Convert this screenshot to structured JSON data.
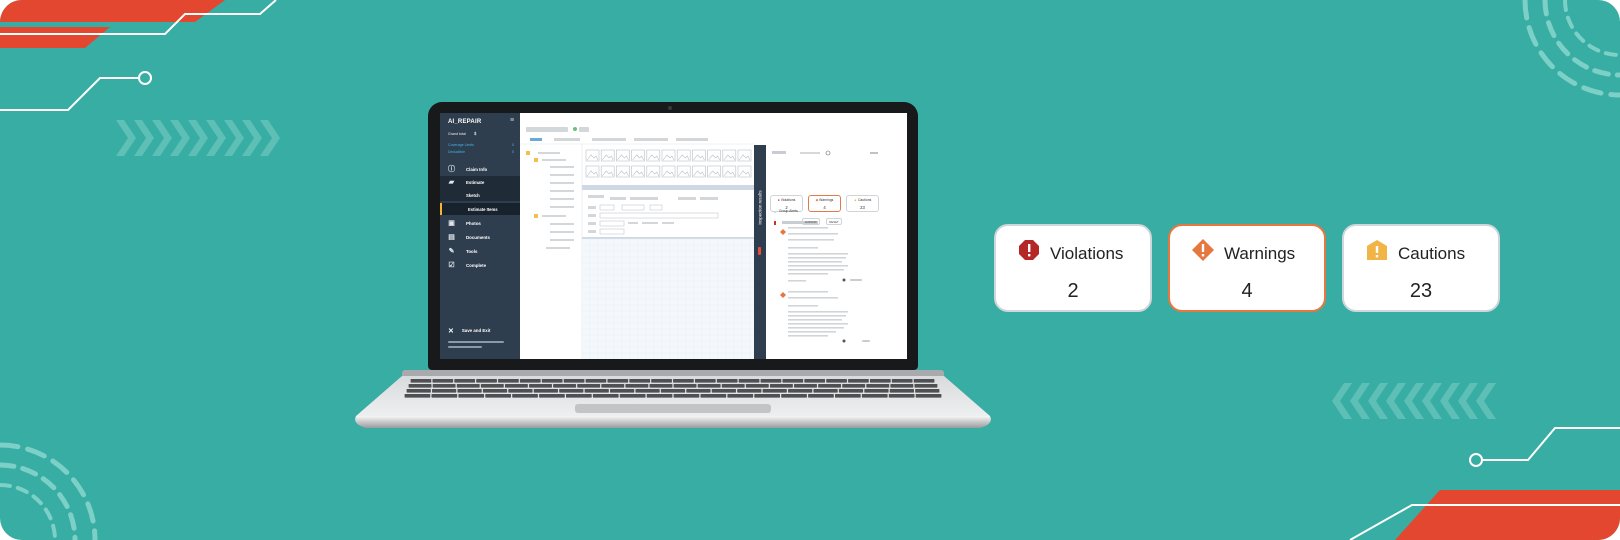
{
  "app": {
    "brand": "AI_REPAIR",
    "grand_total_label": "Grand total",
    "grand_total_value": "$",
    "links": [
      {
        "label": "Coverage Limits",
        "count": "0"
      },
      {
        "label": "Deductible",
        "count": "0"
      }
    ],
    "nav": [
      {
        "label": "Claim Info",
        "icon": "info-icon"
      },
      {
        "label": "Estimate",
        "icon": "car-icon"
      },
      {
        "label": "Sketch",
        "icon": ""
      },
      {
        "label": "Estimate Items",
        "icon": ""
      },
      {
        "label": "Photos",
        "icon": "photo-icon"
      },
      {
        "label": "Documents",
        "icon": "document-icon"
      },
      {
        "label": "Tools",
        "icon": "wrench-icon"
      },
      {
        "label": "Complete",
        "icon": "check-icon"
      }
    ],
    "save_label": "Save and Exit"
  },
  "inspection": {
    "tab_label": "Inspection results",
    "cards": [
      {
        "label": "Violations",
        "value": "2"
      },
      {
        "label": "Warnings",
        "value": "4"
      },
      {
        "label": "Cautions",
        "value": "23"
      }
    ],
    "buttons": [
      "EXPAND",
      "RESET"
    ],
    "group_alerts": "Group Alerts"
  },
  "summary": [
    {
      "label": "Violations",
      "value": "2",
      "icon": "violation-octagon-icon",
      "color": "#B52626"
    },
    {
      "label": "Warnings",
      "value": "4",
      "icon": "warning-diamond-icon",
      "color": "#E5773F"
    },
    {
      "label": "Cautions",
      "value": "23",
      "icon": "caution-shield-icon",
      "color": "#F2B446"
    }
  ],
  "colors": {
    "background": "#38ADA3",
    "accent_red": "#E4472F",
    "sidebar": "#2F3E4F",
    "warning_border": "#E5773F"
  }
}
